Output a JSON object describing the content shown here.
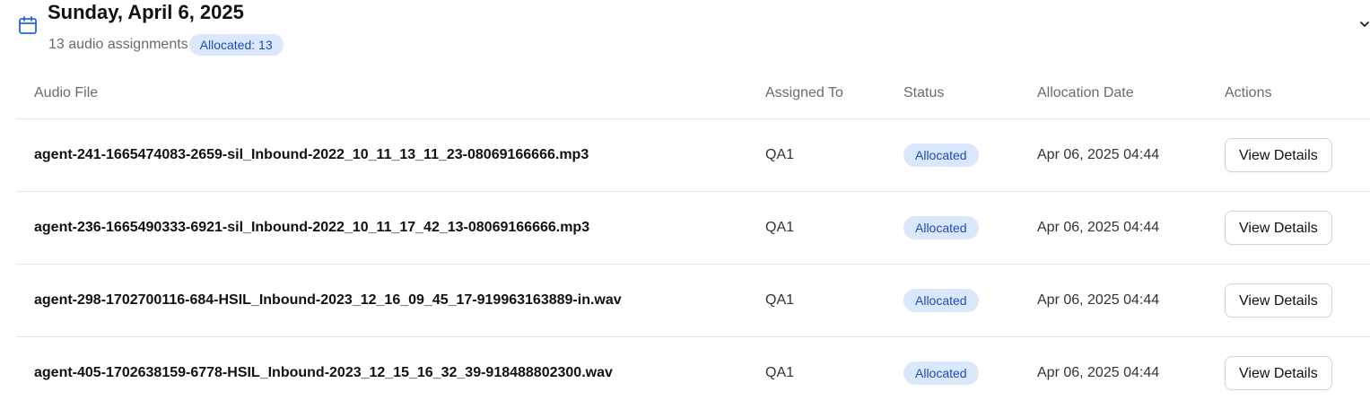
{
  "group": {
    "date_title": "Sunday, April 6, 2025",
    "count_text": "13 audio assignments",
    "allocated_badge": "Allocated: 13",
    "icon": "calendar-icon",
    "toggle_icon": "chevron-down-icon"
  },
  "table": {
    "headers": {
      "audio_file": "Audio File",
      "assigned_to": "Assigned To",
      "status": "Status",
      "allocation_date": "Allocation Date",
      "actions": "Actions"
    },
    "rows": [
      {
        "file": "agent-241-1665474083-2659-sil_Inbound-2022_10_11_13_11_23-08069166666.mp3",
        "assigned_to": "QA1",
        "status": "Allocated",
        "date": "Apr 06, 2025 04:44",
        "action": "View Details"
      },
      {
        "file": "agent-236-1665490333-6921-sil_Inbound-2022_10_11_17_42_13-08069166666.mp3",
        "assigned_to": "QA1",
        "status": "Allocated",
        "date": "Apr 06, 2025 04:44",
        "action": "View Details"
      },
      {
        "file": "agent-298-1702700116-684-HSIL_Inbound-2023_12_16_09_45_17-919963163889-in.wav",
        "assigned_to": "QA1",
        "status": "Allocated",
        "date": "Apr 06, 2025 04:44",
        "action": "View Details"
      },
      {
        "file": "agent-405-1702638159-6778-HSIL_Inbound-2023_12_15_16_32_39-918488802300.wav",
        "assigned_to": "QA1",
        "status": "Allocated",
        "date": "Apr 06, 2025 04:44",
        "action": "View Details"
      }
    ]
  },
  "colors": {
    "accent": "#2563eb",
    "badge_bg": "#dbe7fb",
    "badge_text": "#1f4db5",
    "divider": "#e5e7eb",
    "muted_text": "#6b6b6b"
  }
}
